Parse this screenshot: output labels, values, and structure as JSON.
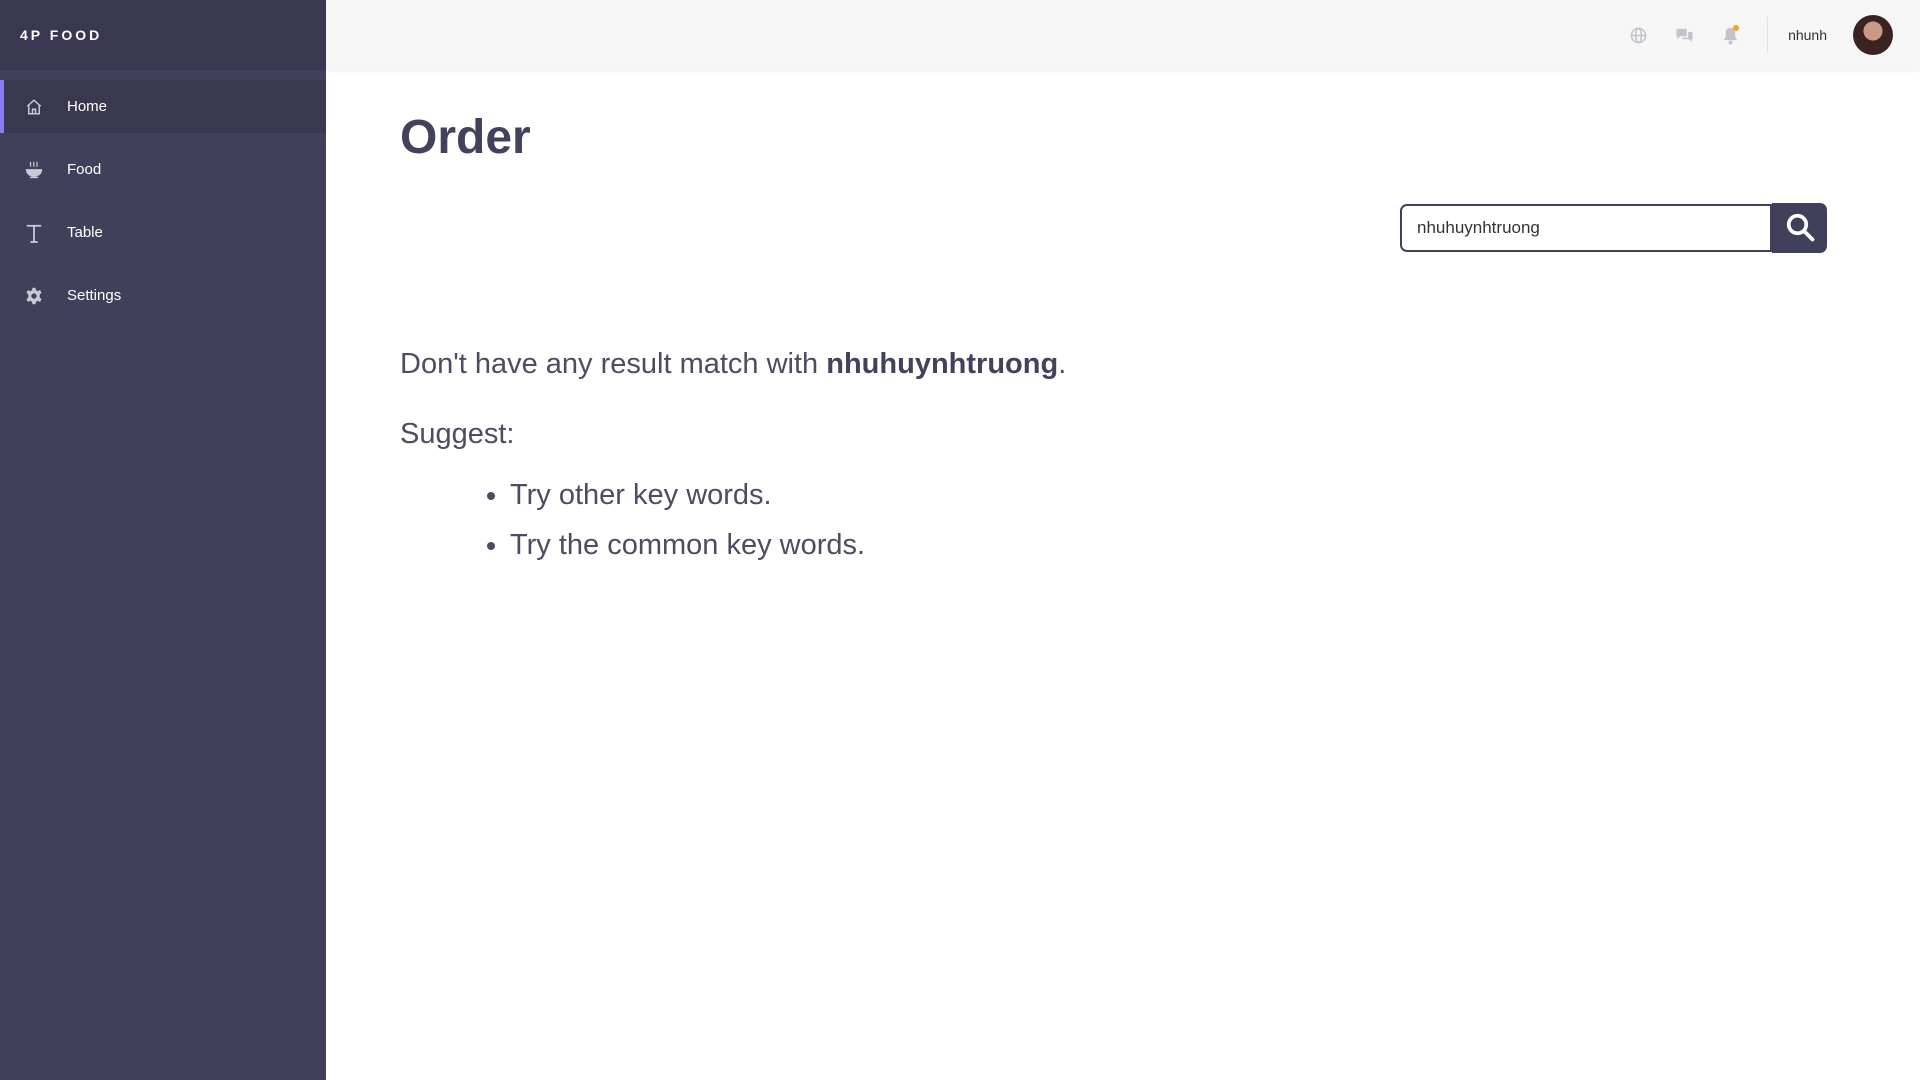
{
  "brand": "4P FOOD",
  "sidebar": {
    "items": [
      {
        "label": "Home",
        "icon": "home-icon",
        "active": true
      },
      {
        "label": "Food",
        "icon": "bowl-icon",
        "active": false
      },
      {
        "label": "Table",
        "icon": "text-t-icon",
        "active": false
      },
      {
        "label": "Settings",
        "icon": "gear-icon",
        "active": false
      }
    ]
  },
  "topbar": {
    "icons": [
      "globe-icon",
      "chat-icon",
      "bell-icon"
    ],
    "username": "nhunh"
  },
  "main": {
    "title": "Order",
    "search": {
      "value": "nhuhuynhtruong",
      "placeholder": ""
    },
    "result_prefix": "Don't have any result match with ",
    "result_query": "nhuhuynhtruong",
    "result_suffix": ".",
    "suggest_label": "Suggest:",
    "suggestions": [
      "Try other key words.",
      "Try the common key words."
    ]
  },
  "colors": {
    "sidebar_bg": "#41405b",
    "brand_bg": "#393850",
    "accent": "#8a7bf0",
    "notification": "#f2a51f",
    "text": "#43425d"
  }
}
